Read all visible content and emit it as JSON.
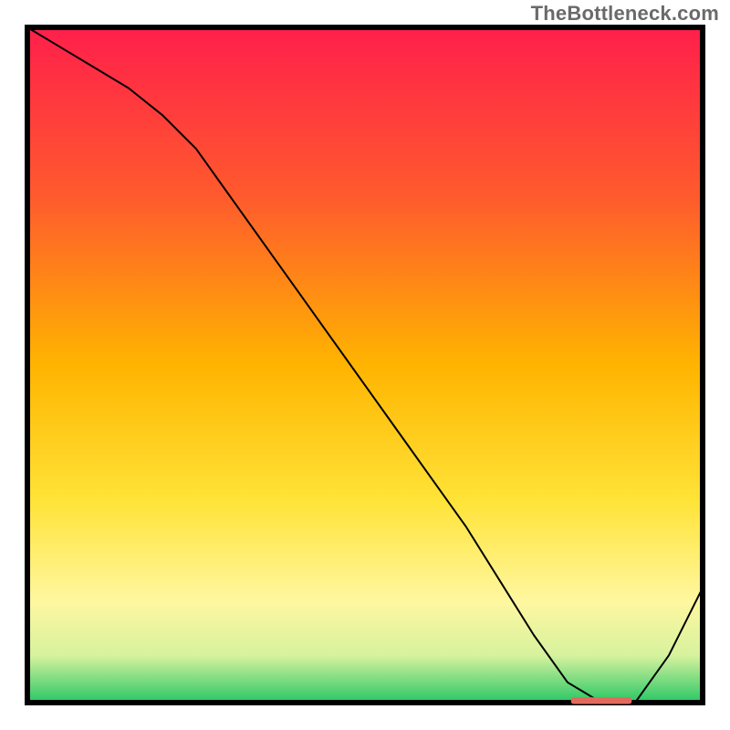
{
  "watermark": "TheBottleneck.com",
  "chart_data": {
    "type": "line",
    "title": "",
    "xlabel": "",
    "ylabel": "",
    "xlim": [
      0,
      100
    ],
    "ylim": [
      0,
      100
    ],
    "grid": false,
    "legend": false,
    "annotations": [],
    "background_gradient": {
      "stops": [
        {
          "offset": 0.0,
          "color": "#ff1f4b"
        },
        {
          "offset": 0.25,
          "color": "#ff5a2d"
        },
        {
          "offset": 0.5,
          "color": "#ffb400"
        },
        {
          "offset": 0.7,
          "color": "#ffe337"
        },
        {
          "offset": 0.85,
          "color": "#fff7a0"
        },
        {
          "offset": 0.93,
          "color": "#d7f29e"
        },
        {
          "offset": 1.0,
          "color": "#28c765"
        }
      ]
    },
    "series": [
      {
        "name": "curve",
        "color": "#000000",
        "width": 2,
        "x": [
          0,
          5,
          10,
          15,
          20,
          25,
          30,
          35,
          40,
          45,
          50,
          55,
          60,
          65,
          70,
          75,
          80,
          85,
          90,
          95,
          100
        ],
        "y": [
          100,
          97,
          94,
          91,
          87,
          82,
          75,
          68,
          61,
          54,
          47,
          40,
          33,
          26,
          18,
          10,
          3,
          0,
          0,
          7,
          17
        ]
      }
    ],
    "marker_bar": {
      "name": "highlight-bar",
      "color": "#e26a5c",
      "x_start": 80.5,
      "x_end": 89.5,
      "y": 0.3,
      "thickness": 1.0
    }
  }
}
